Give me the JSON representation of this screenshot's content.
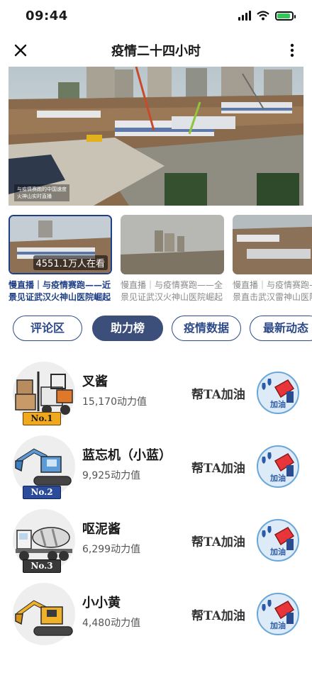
{
  "status": {
    "time": "09:44"
  },
  "nav": {
    "title": "疫情二十四小时"
  },
  "hero": {
    "watermark_line1": "与疫情赛跑的中国速度",
    "watermark_line2": "火神山实时直播"
  },
  "thumbs": [
    {
      "badge": "4551.1万人在看",
      "caption": "慢直播｜与疫情赛跑——近景见证武汉火神山医院崛起"
    },
    {
      "caption": "慢直播｜与疫情赛跑——全景见证武汉火神山医院崛起"
    },
    {
      "caption": "慢直播｜与疫情赛跑——近景直击武汉雷神山医院"
    }
  ],
  "tabs": [
    "评论区",
    "助力榜",
    "疫情数据",
    "最新动态"
  ],
  "active_tab": "助力榜",
  "cheer_label": "帮TA加油",
  "cheer_icon_label": "加油",
  "ranking": [
    {
      "name": "叉酱",
      "score": "15,170动力值",
      "rank": "No.1",
      "icon": "forklift-icon"
    },
    {
      "name": "蓝忘机（小蓝）",
      "score": "9,925动力值",
      "rank": "No.2",
      "icon": "excavator-blue-icon"
    },
    {
      "name": "呕泥酱",
      "score": "6,299动力值",
      "rank": "No.3",
      "icon": "cement-mixer-icon"
    },
    {
      "name": "小小黄",
      "score": "4,480动力值",
      "rank": "",
      "icon": "excavator-yellow-icon"
    }
  ],
  "colors": {
    "accent": "#3c4e7a",
    "tab_border": "#2d4a8a",
    "active_caption": "#1f3f86"
  }
}
